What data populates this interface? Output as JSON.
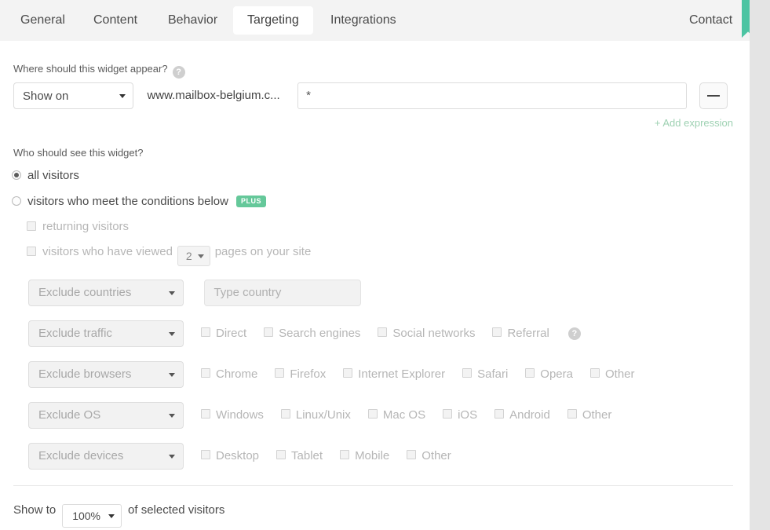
{
  "tabs": [
    {
      "id": "general",
      "label": "General",
      "active": false
    },
    {
      "id": "content",
      "label": "Content",
      "active": false
    },
    {
      "id": "behavior",
      "label": "Behavior",
      "active": false
    },
    {
      "id": "targeting",
      "label": "Targeting",
      "active": true
    },
    {
      "id": "integrations",
      "label": "Integrations",
      "active": false
    },
    {
      "id": "contact",
      "label": "Contact",
      "active": false
    }
  ],
  "targeting": {
    "where_question": "Where should this widget appear?",
    "who_question": "Who should see this widget?",
    "show_on_select": "Show on",
    "domain": "www.mailbox-belgium.c...",
    "expression_value": "*",
    "minus_button": "—",
    "add_expression": "+ Add expression",
    "radios": [
      {
        "id": "all-visitors",
        "label": "all visitors",
        "checked": true
      },
      {
        "id": "conditions-below",
        "label": "visitors who meet the conditions below",
        "checked": false,
        "badge": "PLUS"
      }
    ],
    "conditions": {
      "returning_label": "returning visitors",
      "viewed_prefix": "visitors who have viewed",
      "viewed_count": "2",
      "viewed_suffix": "pages on your site"
    },
    "exclude_rows": [
      {
        "id": "countries",
        "select_label": "Exclude countries",
        "input_placeholder": "Type country",
        "options": []
      },
      {
        "id": "traffic",
        "select_label": "Exclude traffic",
        "options": [
          "Direct",
          "Search engines",
          "Social networks",
          "Referral"
        ],
        "has_help": true
      },
      {
        "id": "browsers",
        "select_label": "Exclude browsers",
        "options": [
          "Chrome",
          "Firefox",
          "Internet Explorer",
          "Safari",
          "Opera",
          "Other"
        ]
      },
      {
        "id": "os",
        "select_label": "Exclude OS",
        "options": [
          "Windows",
          "Linux/Unix",
          "Mac OS",
          "iOS",
          "Android",
          "Other"
        ]
      },
      {
        "id": "devices",
        "select_label": "Exclude devices",
        "options": [
          "Desktop",
          "Tablet",
          "Mobile",
          "Other"
        ]
      }
    ],
    "footer": {
      "show_to_prefix": "Show to",
      "percent": "100%",
      "show_to_suffix": "of selected visitors"
    }
  },
  "colors": {
    "accent_green": "#4cc4a2",
    "badge_green": "#65c89a",
    "link_green": "#9ed1b2",
    "tabbar_bg": "#f3f3f3",
    "gutter_bg": "#e4e4e4"
  }
}
